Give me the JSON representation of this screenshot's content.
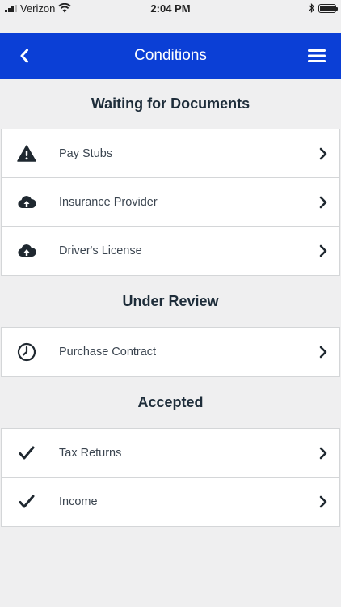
{
  "status_bar": {
    "carrier": "Verizon",
    "time": "2:04 PM"
  },
  "nav": {
    "title": "Conditions",
    "back_icon": "chevron-left-icon",
    "menu_icon": "hamburger-menu-icon"
  },
  "sections": [
    {
      "title": "Waiting for Documents",
      "items": [
        {
          "label": "Pay Stubs",
          "icon": "warning-icon"
        },
        {
          "label": "Insurance Provider",
          "icon": "cloud-upload-icon"
        },
        {
          "label": "Driver's License",
          "icon": "cloud-upload-icon"
        }
      ]
    },
    {
      "title": "Under Review",
      "items": [
        {
          "label": "Purchase Contract",
          "icon": "clock-icon"
        }
      ]
    },
    {
      "title": "Accepted",
      "items": [
        {
          "label": "Tax Returns",
          "icon": "checkmark-icon"
        },
        {
          "label": "Income",
          "icon": "checkmark-icon"
        }
      ]
    }
  ],
  "colors": {
    "nav_background": "#0b3fd6",
    "page_background": "#efeff0"
  }
}
